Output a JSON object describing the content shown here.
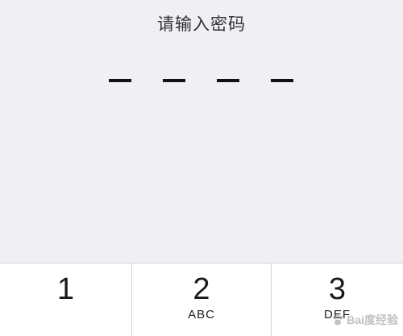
{
  "passcode_screen": {
    "prompt": "请输入密码",
    "digits_entered": 0,
    "digit_slots": 4
  },
  "keypad": {
    "keys": [
      {
        "digit": "1",
        "letters": ""
      },
      {
        "digit": "2",
        "letters": "ABC"
      },
      {
        "digit": "3",
        "letters": "DEF"
      }
    ]
  },
  "watermark": {
    "text": "Bai度经验"
  },
  "colors": {
    "background": "#efeff4",
    "keypad_background": "#ffffff",
    "dash": "#111111",
    "divider": "#d4d4d8"
  }
}
